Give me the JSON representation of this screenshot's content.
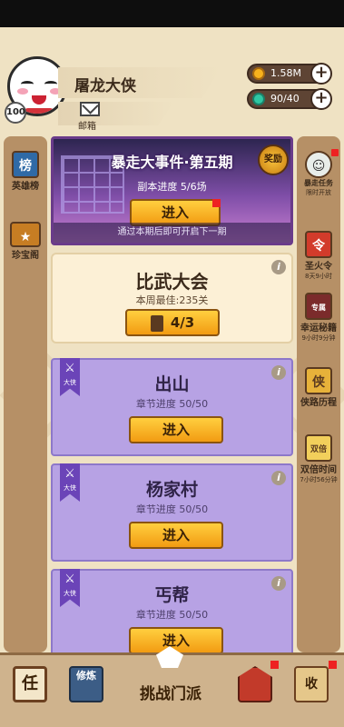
{
  "player": {
    "name": "屠龙大侠",
    "level": "100",
    "mail_label": "邮箱"
  },
  "resources": [
    {
      "icon": "coin-icon",
      "value": "1.58M"
    },
    {
      "icon": "gem-icon",
      "value": "90/40"
    }
  ],
  "left_sidebar": [
    {
      "icon": "ranking-scroll-icon",
      "label": "英雄榜",
      "glyph": "榜"
    },
    {
      "icon": "treasure-chest-icon",
      "label": "珍宝阁"
    }
  ],
  "right_sidebar": [
    {
      "icon": "crazy-task-icon",
      "label": "暴走任务",
      "sub": "限时开放"
    },
    {
      "icon": "fire-token-icon",
      "label": "圣火令",
      "sub": "8天9小时",
      "glyph": "令"
    },
    {
      "icon": "secret-book-icon",
      "label": "幸运秘籍",
      "sub": "9小时9分钟",
      "glyph": "专属"
    },
    {
      "icon": "hero-path-icon",
      "label": "侠路历程",
      "glyph": "侠"
    },
    {
      "icon": "double-time-icon",
      "label": "双倍时间",
      "sub": "7小时56分钟",
      "glyph": "双倍"
    }
  ],
  "event": {
    "title": "暴走大事件·第五期",
    "progress": "副本进度 5/6场",
    "enter": "进入",
    "reward": "奖励",
    "notice": "通过本期后即可开启下一期"
  },
  "arena": {
    "title": "比武大会",
    "best": "本周最佳:235关",
    "tickets": "4/3"
  },
  "stages": [
    {
      "title": "出山",
      "badge": "大侠",
      "progress": "章节进度 50/50",
      "enter": "进入"
    },
    {
      "title": "杨家村",
      "badge": "大侠",
      "progress": "章节进度 50/50",
      "enter": "进入"
    },
    {
      "title": "丐帮",
      "badge": "大侠",
      "progress": "章节进度 50/50",
      "enter": "进入"
    }
  ],
  "bottom_nav": {
    "task_glyph": "任",
    "train_glyph": "修炼",
    "challenge_label": "挑战门派",
    "collect_glyph": "收"
  },
  "colors": {
    "gold": "#f7b21d",
    "purple_card": "#b7a2e4",
    "dark_brown": "#5e4434"
  }
}
